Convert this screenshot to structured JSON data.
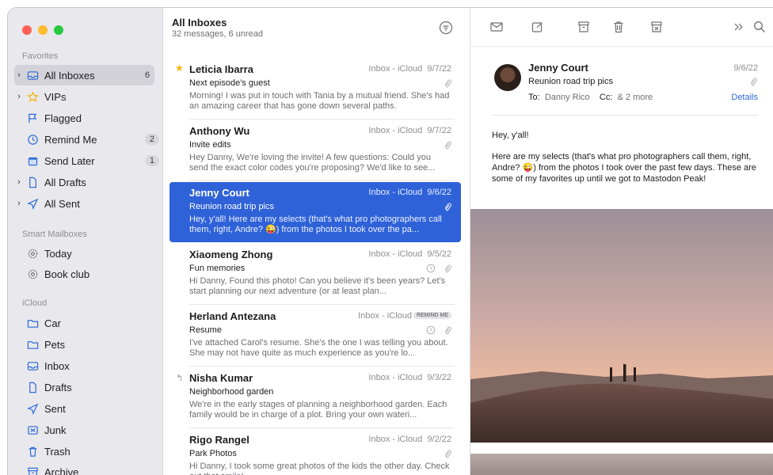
{
  "sidebar": {
    "sections": {
      "favorites": "Favorites",
      "smart": "Smart Mailboxes",
      "icloud": "iCloud"
    },
    "favorites": [
      {
        "label": "All Inboxes",
        "count": "6",
        "icon": "tray-icon"
      },
      {
        "label": "VIPs",
        "count": "",
        "icon": "star-icon"
      },
      {
        "label": "Flagged",
        "count": "",
        "icon": "flag-icon"
      },
      {
        "label": "Remind Me",
        "count": "2",
        "icon": "clock-icon"
      },
      {
        "label": "Send Later",
        "count": "1",
        "icon": "calendar-icon"
      },
      {
        "label": "All Drafts",
        "count": "",
        "icon": "document-icon"
      },
      {
        "label": "All Sent",
        "count": "",
        "icon": "paperplane-icon"
      }
    ],
    "smart": [
      {
        "label": "Today",
        "icon": "gear-icon"
      },
      {
        "label": "Book club",
        "icon": "gear-icon"
      }
    ],
    "icloud": [
      {
        "label": "Car",
        "icon": "folder-icon"
      },
      {
        "label": "Pets",
        "icon": "folder-icon"
      },
      {
        "label": "Inbox",
        "icon": "tray-icon"
      },
      {
        "label": "Drafts",
        "icon": "document-icon"
      },
      {
        "label": "Sent",
        "icon": "paperplane-icon"
      },
      {
        "label": "Junk",
        "icon": "junk-icon"
      },
      {
        "label": "Trash",
        "icon": "trash-icon"
      },
      {
        "label": "Archive",
        "icon": "archive-icon"
      }
    ]
  },
  "list": {
    "title": "All Inboxes",
    "subtitle": "32 messages, 6 unread",
    "messages": [
      {
        "sender": "Leticia Ibarra",
        "mailbox": "Inbox - iCloud",
        "date": "9/7/22",
        "subject": "Next episode's guest",
        "preview": "Morning! I was put in touch with Tania by a mutual friend. She's had an amazing career that has gone down several paths."
      },
      {
        "sender": "Anthony Wu",
        "mailbox": "Inbox - iCloud",
        "date": "9/7/22",
        "subject": "Invite edits",
        "preview": "Hey Danny, We're loving the invite! A few questions: Could you send the exact color codes you're proposing? We'd like to see..."
      },
      {
        "sender": "Jenny Court",
        "mailbox": "Inbox - iCloud",
        "date": "9/6/22",
        "subject": "Reunion road trip pics",
        "preview": "Hey, y'all! Here are my selects (that's what pro photographers call them, right, Andre? 😜) from the photos I took over the pa..."
      },
      {
        "sender": "Xiaomeng Zhong",
        "mailbox": "Inbox - iCloud",
        "date": "9/5/22",
        "subject": "Fun memories",
        "preview": "Hi Danny, Found this photo! Can you believe it's been years? Let's start planning our next adventure (or at least plan..."
      },
      {
        "sender": "Herland Antezana",
        "mailbox": "Inbox - iCloud",
        "date": "REMIND ME",
        "subject": "Resume",
        "preview": "I've attached Carol's resume. She's the one I was telling you about. She may not have quite as much experience as you're lo..."
      },
      {
        "sender": "Nisha Kumar",
        "mailbox": "Inbox - iCloud",
        "date": "9/3/22",
        "subject": "Neighborhood garden",
        "preview": "We're in the early stages of planning a neighborhood garden. Each family would be in charge of a plot. Bring your own wateri..."
      },
      {
        "sender": "Rigo Rangel",
        "mailbox": "Inbox - iCloud",
        "date": "9/2/22",
        "subject": "Park Photos",
        "preview": "Hi Danny, I took some great photos of the kids the other day. Check out that smile!"
      }
    ]
  },
  "reader": {
    "name": "Jenny Court",
    "date": "9/6/22",
    "subject": "Reunion road trip pics",
    "to_label": "To:",
    "to": "Danny Rico",
    "cc_label": "Cc:",
    "cc": "& 2 more",
    "details": "Details",
    "greeting": "Hey, y'all!",
    "body": "Here are my selects (that's what pro photographers call them, right, Andre? 😜) from the photos I took over the past few days. These are some of my favorites up until we got to Mastodon Peak!"
  },
  "colors": {
    "accent": "#2f62d8",
    "sidebar_bg": "#e9e8ec",
    "star": "#f5b400"
  }
}
